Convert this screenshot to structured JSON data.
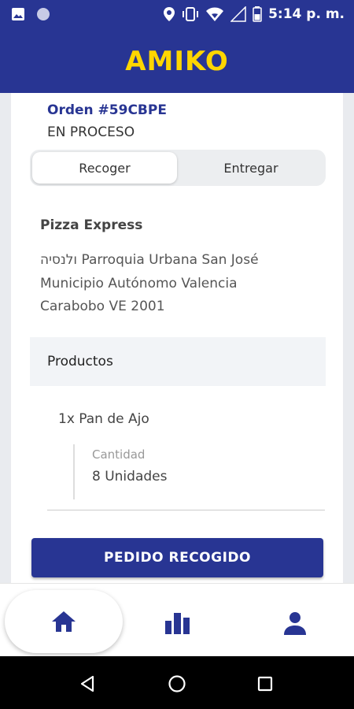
{
  "status_bar": {
    "time": "5:14 p. m.",
    "icons": [
      "image-icon",
      "circle-icon",
      "location-icon",
      "vibrate-icon",
      "wifi-icon",
      "signal-icon",
      "battery-icon"
    ]
  },
  "app": {
    "logo": "AMIKO",
    "brand_color": "#283593",
    "logo_color": "#FFD600"
  },
  "order": {
    "title": "Orden #59CBPE",
    "status": "EN PROCESO"
  },
  "tabs": [
    {
      "label": "Recoger",
      "active": true
    },
    {
      "label": "Entregar",
      "active": false
    }
  ],
  "store": {
    "name": "Pizza Express",
    "address_lines": [
      "ולנסיה Parroquia Urbana San José",
      "Municipio Autónomo Valencia",
      "Carabobo VE 2001"
    ]
  },
  "products": {
    "header": "Productos",
    "items": [
      {
        "name": "1x Pan de Ajo",
        "qty_label": "Cantidad",
        "qty_value": "8 Unidades"
      }
    ]
  },
  "action": {
    "label": "PEDIDO RECOGIDO"
  },
  "bottom_nav": [
    {
      "name": "home",
      "icon": "home-icon",
      "active": true
    },
    {
      "name": "stats",
      "icon": "bar-chart-icon",
      "active": false
    },
    {
      "name": "profile",
      "icon": "person-icon",
      "active": false
    }
  ],
  "system_nav": [
    "back-icon",
    "home-circle-icon",
    "recents-icon"
  ]
}
